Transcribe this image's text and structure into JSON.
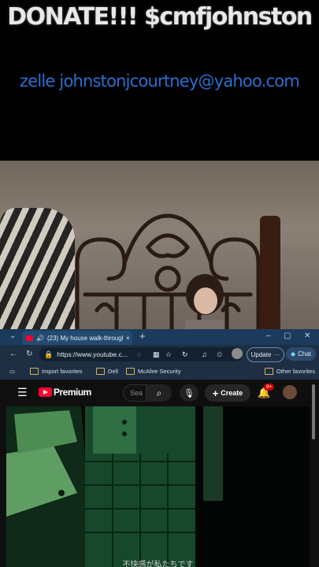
{
  "overlay": {
    "donate_text": "DONATE!!! $cmfjohnston",
    "zelle_text": "zelle johnstonjcourtney@yahoo.com"
  },
  "browser": {
    "tab": {
      "title": "(23) My house walk-through",
      "favicon": "youtube-icon",
      "audio_icon": "speaker-icon"
    },
    "address_url": "https://www.youtube.c...",
    "update_label": "Update",
    "chat_label": "Chat",
    "favorites": {
      "import_label": "Import favorites",
      "dell_label": "Dell",
      "mcafee_label": "McAfee Security",
      "other_label": "Other favorites"
    }
  },
  "youtube": {
    "logo_label": "Premium",
    "search_placeholder": "Sea",
    "create_label": "Create",
    "notification_count": "9+"
  },
  "video": {
    "subtitle": "不快感が私たちです"
  },
  "colors": {
    "zelle_blue": "#2a6fd0",
    "tab_bar": "#1b3a5c",
    "youtube_red": "#ff0033",
    "notification_red": "#cc0000"
  }
}
